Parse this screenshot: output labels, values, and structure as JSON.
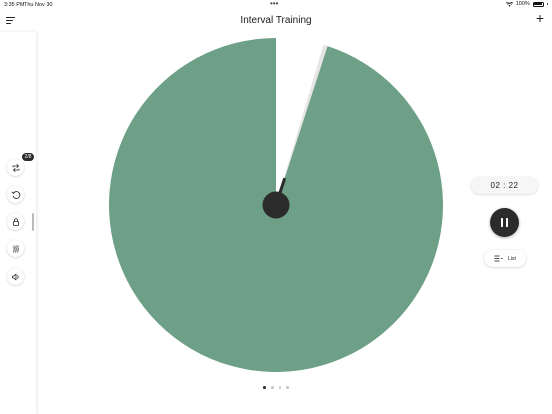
{
  "status_bar": {
    "time": "3:35 PM",
    "date": "Thu Nov 30",
    "battery": "100%"
  },
  "header": {
    "title": "Interval Training",
    "add_label": "+"
  },
  "sidebar": {
    "items": [
      {
        "name": "repeat",
        "badge": "2/8"
      },
      {
        "name": "reset"
      },
      {
        "name": "lock"
      },
      {
        "name": "heat"
      },
      {
        "name": "sound"
      }
    ]
  },
  "timer": {
    "display": "02 : 22",
    "remaining_fraction": 0.95
  },
  "controls": {
    "list_label": "List"
  },
  "pagination": {
    "total": 4,
    "active": 0
  },
  "colors": {
    "wheel_fill": "#6da086",
    "knob": "#2b2b2b"
  }
}
